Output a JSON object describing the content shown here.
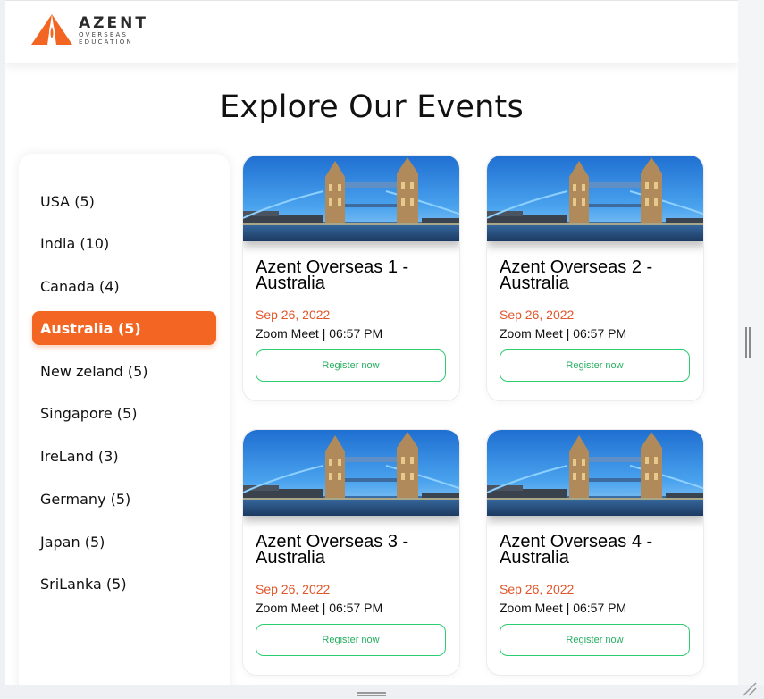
{
  "brand": {
    "name": "AZENT",
    "sub_line1": "OVERSEAS",
    "sub_line2": "EDUCATION",
    "accent": "#f26522"
  },
  "page": {
    "title": "Explore Our Events"
  },
  "sidebar": {
    "items": [
      {
        "label": "USA (5)",
        "active": false
      },
      {
        "label": "India (10)",
        "active": false
      },
      {
        "label": "Canada (4)",
        "active": false
      },
      {
        "label": "Australia (5)",
        "active": true
      },
      {
        "label": "New zeland (5)",
        "active": false
      },
      {
        "label": "Singapore (5)",
        "active": false
      },
      {
        "label": "IreLand (3)",
        "active": false
      },
      {
        "label": "Germany (5)",
        "active": false
      },
      {
        "label": "Japan (5)",
        "active": false
      },
      {
        "label": "SriLanka (5)",
        "active": false
      }
    ]
  },
  "events": [
    {
      "title": "Azent Overseas 1 - Australia",
      "date": "Sep 26, 2022",
      "meta": "Zoom Meet | 06:57 PM",
      "button": "Register now",
      "image": "tower-bridge-photo"
    },
    {
      "title": "Azent Overseas 2 - Australia",
      "date": "Sep 26, 2022",
      "meta": "Zoom Meet | 06:57 PM",
      "button": "Register now",
      "image": "tower-bridge-photo"
    },
    {
      "title": "Azent Overseas 3 - Australia",
      "date": "Sep 26, 2022",
      "meta": "Zoom Meet | 06:57 PM",
      "button": "Register now",
      "image": "tower-bridge-photo"
    },
    {
      "title": "Azent Overseas 4 - Australia",
      "date": "Sep 26, 2022",
      "meta": "Zoom Meet | 06:57 PM",
      "button": "Register now",
      "image": "tower-bridge-photo"
    }
  ],
  "colors": {
    "date": "#e0562a",
    "button_border": "#2ecc71",
    "button_text": "#27ae60"
  }
}
